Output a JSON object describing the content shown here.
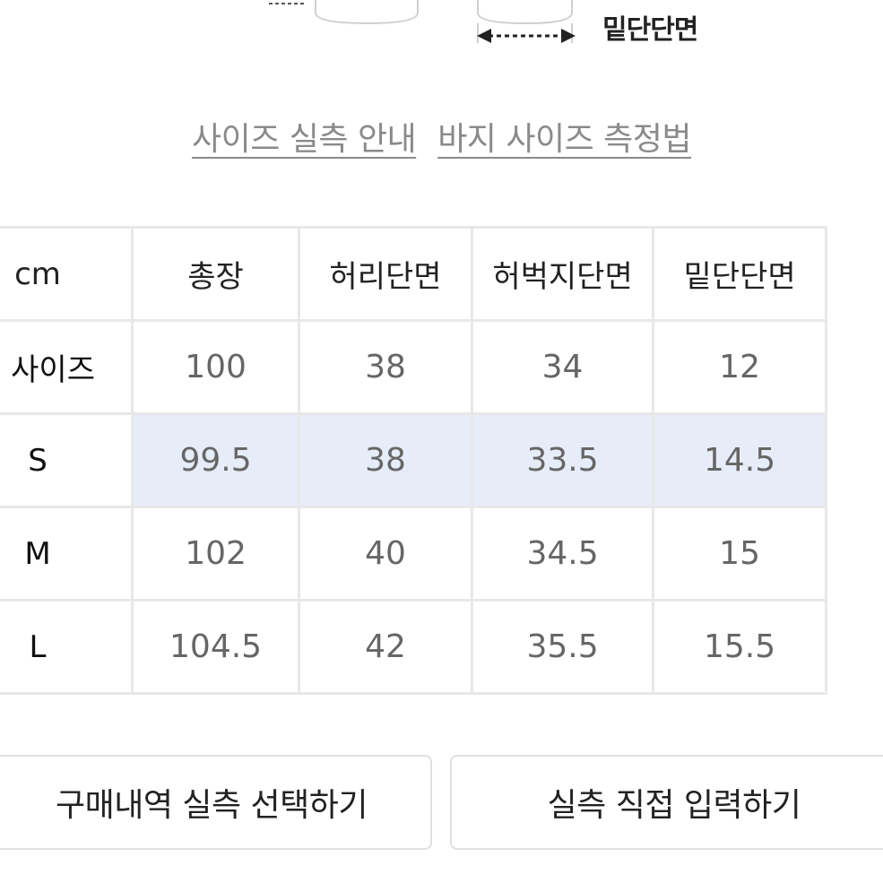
{
  "diagram": {
    "label": "밑단단면"
  },
  "links": {
    "size_guide": "사이즈 실측 안내",
    "pants_measure": "바지 사이즈 측정법"
  },
  "table": {
    "headers": [
      "cm",
      "총장",
      "허리단면",
      "허벅지단면",
      "밑단단면"
    ],
    "rows": [
      {
        "label": "내 사이즈",
        "values": [
          "100",
          "38",
          "34",
          "12"
        ],
        "selected": false
      },
      {
        "label": "S",
        "values": [
          "99.5",
          "38",
          "33.5",
          "14.5"
        ],
        "selected": true
      },
      {
        "label": "M",
        "values": [
          "102",
          "40",
          "34.5",
          "15"
        ],
        "selected": false
      },
      {
        "label": "L",
        "values": [
          "104.5",
          "42",
          "35.5",
          "15.5"
        ],
        "selected": false
      }
    ]
  },
  "buttons": {
    "purchase_history": "구매내역 실측 선택하기",
    "direct_input": "실측 직접 입력하기"
  },
  "colors": {
    "selected_row": "#e6ecf8",
    "border": "#e8e8e8",
    "link": "#8a8a8a"
  }
}
